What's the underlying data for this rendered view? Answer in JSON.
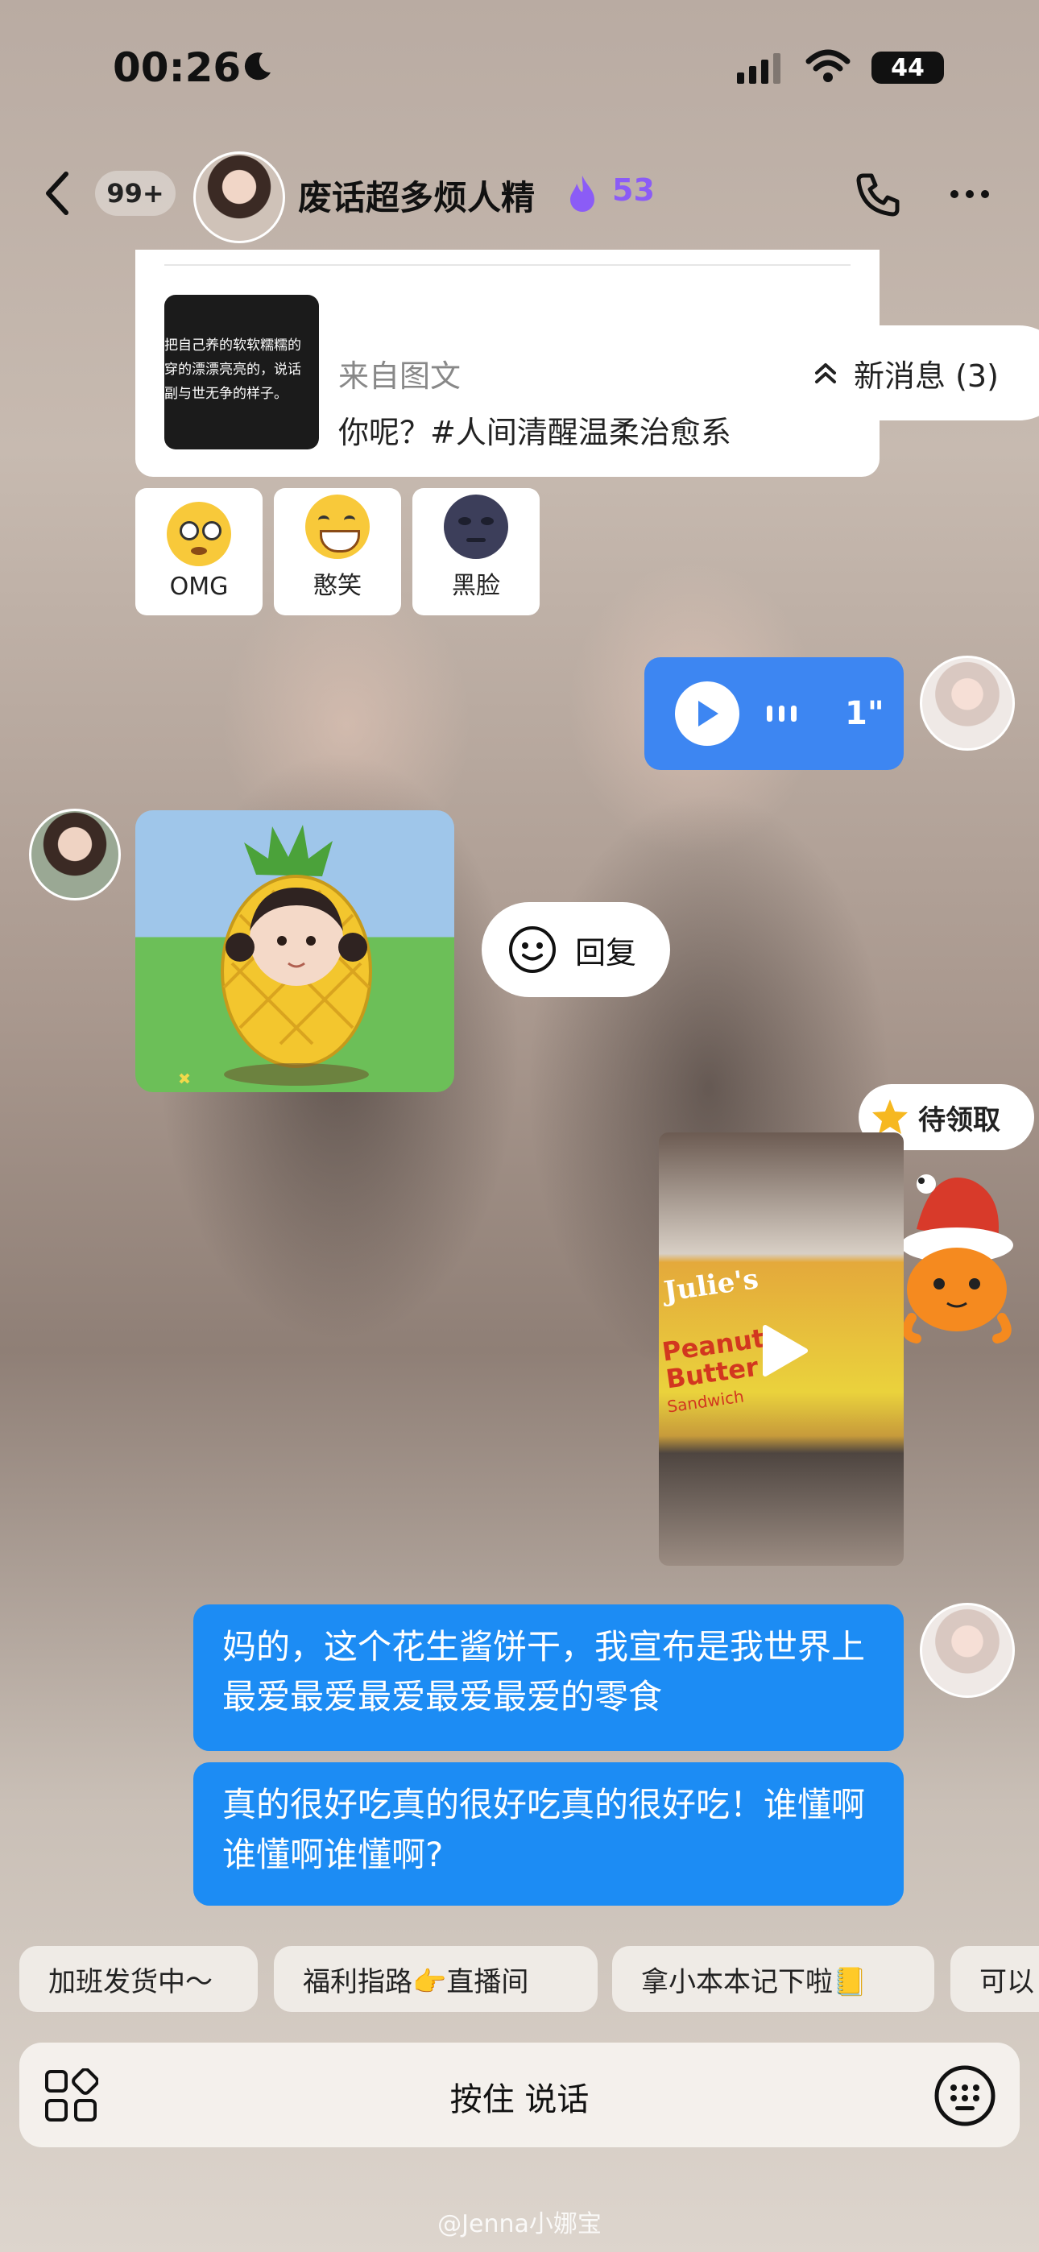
{
  "status": {
    "time": "00:26",
    "battery": "44"
  },
  "header": {
    "unread_badge": "99+",
    "name": "废话超多烦人精",
    "streak": "53"
  },
  "shared_card": {
    "thumb_lines": [
      "把自己养的软软糯糯的",
      "穿的漂漂亮亮的，说话",
      "副与世无争的样子。"
    ],
    "source": "来自图文",
    "text": "你呢？#人间清醒温柔治愈系"
  },
  "new_messages": "新消息 (3)",
  "reactions": [
    {
      "label": "OMG"
    },
    {
      "label": "憨笑"
    },
    {
      "label": "黑脸"
    }
  ],
  "voice": {
    "duration": "1\""
  },
  "reply_label": "回复",
  "gift_label": "待领取",
  "video": {
    "brand": "Julie's",
    "product": "Peanut Butter",
    "sub": "Sandwich"
  },
  "messages": [
    {
      "text": "妈的，这个花生酱饼干，我宣布是我世界上最爱最爱最爱最爱最爱的零食"
    },
    {
      "text": "真的很好吃真的很好吃真的很好吃！谁懂啊谁懂啊谁懂啊?"
    }
  ],
  "quick_replies": [
    "加班发货中～",
    "福利指路👉直播间",
    "拿小本本记下啦📒",
    "可以"
  ],
  "input": {
    "hold_to_talk": "按住 说话"
  },
  "watermark": "@Jenna小娜宝",
  "colors": {
    "bubble": "#1c8cf4",
    "voice": "#3d86f2",
    "streak": "#8b5cf6"
  }
}
